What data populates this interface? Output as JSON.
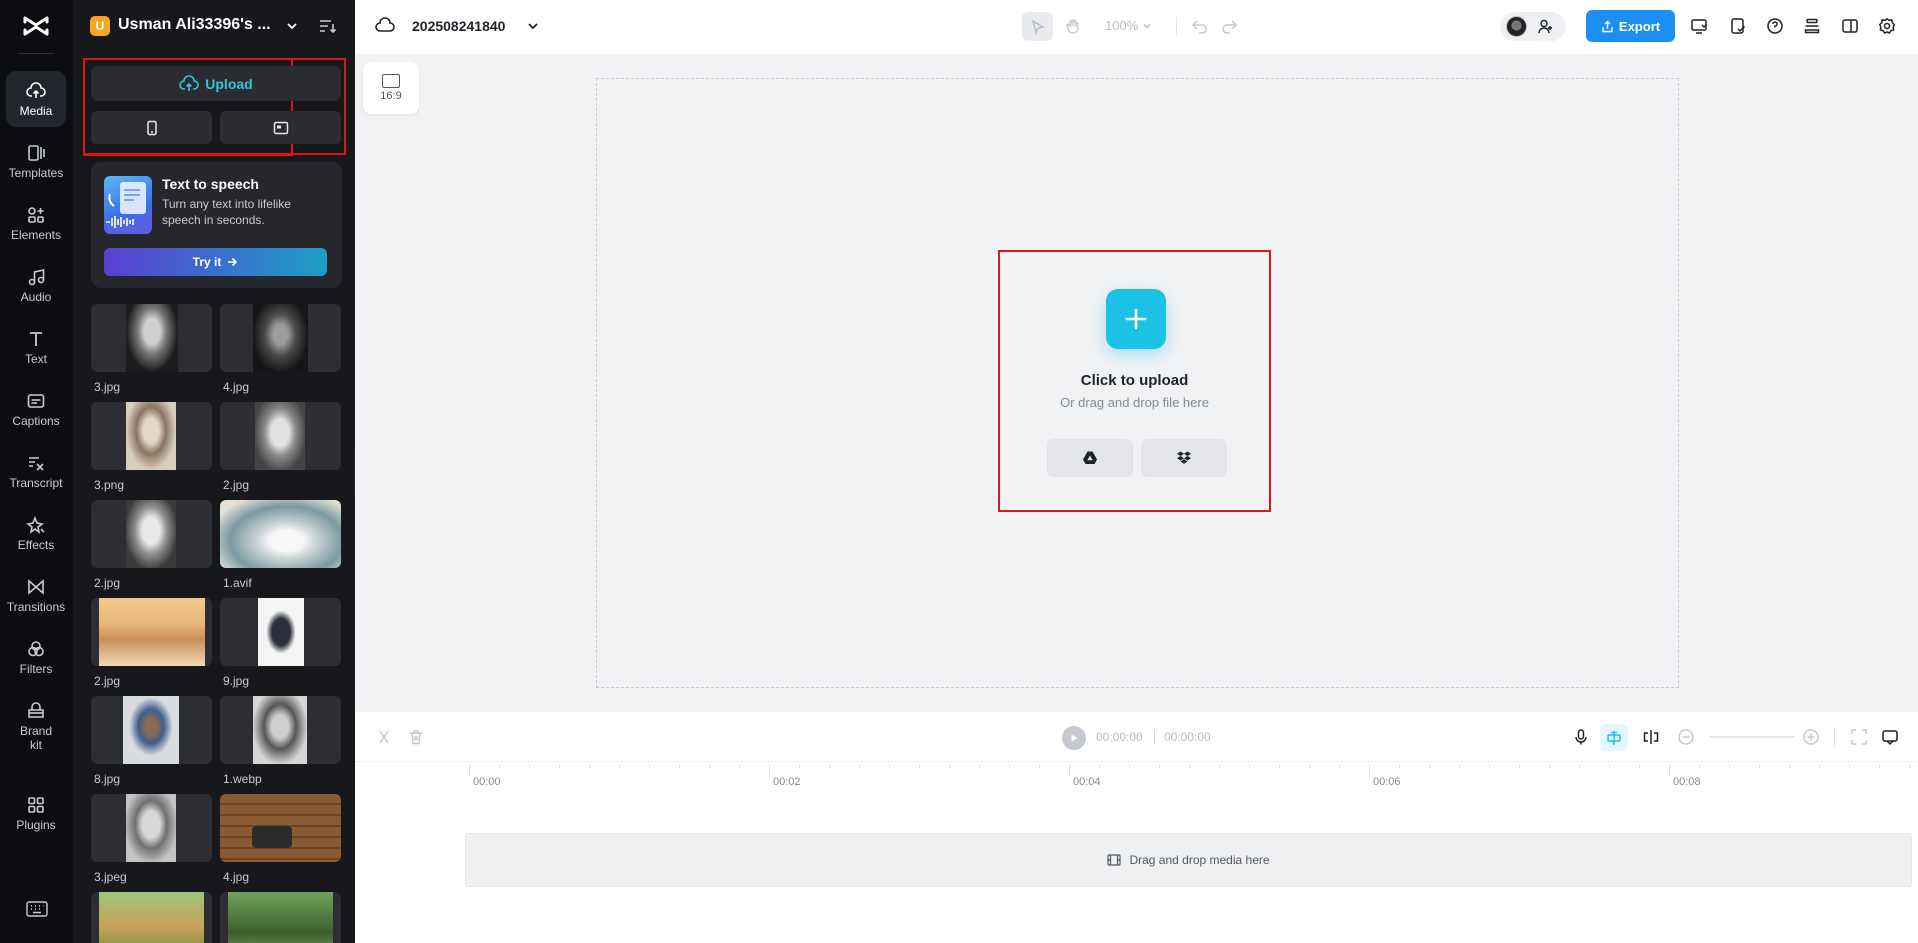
{
  "rail": {
    "items": [
      {
        "id": "media",
        "label": "Media",
        "icon": "cloud-upload-icon",
        "active": true
      },
      {
        "id": "templates",
        "label": "Templates",
        "icon": "templates-icon"
      },
      {
        "id": "elements",
        "label": "Elements",
        "icon": "elements-icon"
      },
      {
        "id": "audio",
        "label": "Audio",
        "icon": "music-note-icon"
      },
      {
        "id": "text",
        "label": "Text",
        "icon": "text-icon"
      },
      {
        "id": "captions",
        "label": "Captions",
        "icon": "captions-icon"
      },
      {
        "id": "transcript",
        "label": "Transcript",
        "icon": "transcript-icon"
      },
      {
        "id": "effects",
        "label": "Effects",
        "icon": "effects-icon"
      },
      {
        "id": "transitions",
        "label": "Transitions",
        "icon": "transitions-icon"
      },
      {
        "id": "filters",
        "label": "Filters",
        "icon": "filters-icon"
      },
      {
        "id": "brandkit",
        "label": "Brand\nkit",
        "icon": "brand-kit-icon"
      },
      {
        "id": "plugins",
        "label": "Plugins",
        "icon": "plugins-icon"
      }
    ]
  },
  "workspace": {
    "initial": "U",
    "name": "Usman Ali33396's ..."
  },
  "upload": {
    "label": "Upload"
  },
  "tts": {
    "title": "Text to speech",
    "desc": "Turn any text into lifelike speech in seconds.",
    "cta": "Try it"
  },
  "media": {
    "items": [
      {
        "name": "3.jpg"
      },
      {
        "name": "4.jpg"
      },
      {
        "name": "3.png"
      },
      {
        "name": "2.jpg"
      },
      {
        "name": "2.jpg"
      },
      {
        "name": "1.avif"
      },
      {
        "name": "2.jpg"
      },
      {
        "name": "9.jpg"
      },
      {
        "name": "8.jpg"
      },
      {
        "name": "1.webp"
      },
      {
        "name": "3.jpeg"
      },
      {
        "name": "4.jpg"
      },
      {
        "name": ""
      },
      {
        "name": ""
      }
    ]
  },
  "topbar": {
    "project": "202508241840",
    "zoom": "100%",
    "export_label": "Export"
  },
  "canvas": {
    "ratio": "16:9",
    "drop_title": "Click to upload",
    "drop_sub": "Or drag and drop file here"
  },
  "timeline": {
    "current_time": "00:00:00",
    "total_time": "00:00:00",
    "ticks": [
      "00:00",
      "00:02",
      "00:04",
      "00:06",
      "00:08"
    ],
    "drop_hint": "Drag and drop media here"
  },
  "colors": {
    "accent": "#1cc1e6",
    "export": "#1e8ff2",
    "highlight": "#e0141e",
    "workspace_badge": "#f5a623"
  }
}
